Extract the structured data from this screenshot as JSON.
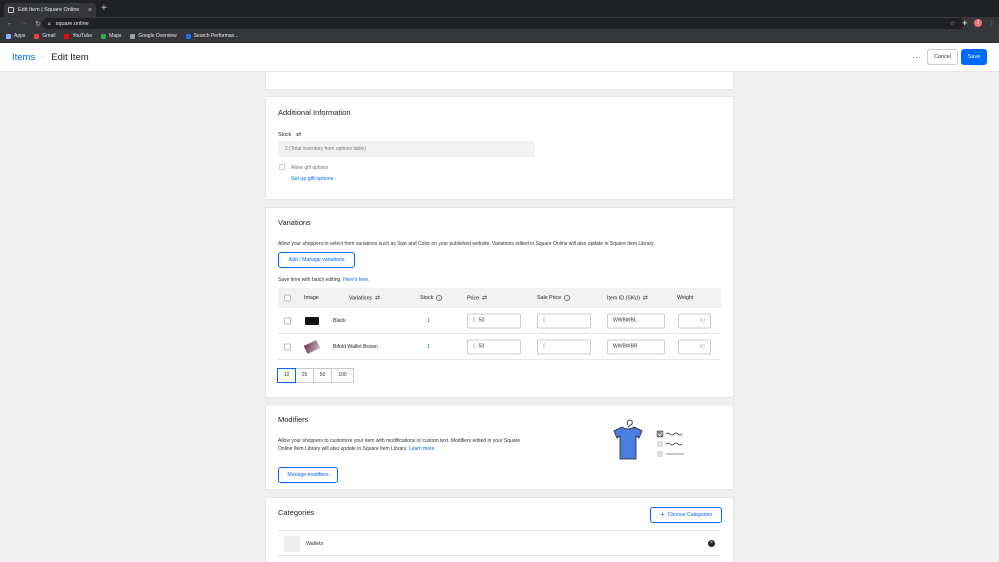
{
  "browser": {
    "tab_title": "Edit Item | Square Online",
    "url": "square.online",
    "profile_initial": "J",
    "bookmarks": [
      {
        "label": "Apps",
        "color": "#8ab4f8"
      },
      {
        "label": "Gmail",
        "color": "#ea4335"
      },
      {
        "label": "YouTube",
        "color": "#ff0000"
      },
      {
        "label": "Maps",
        "color": "#34a853"
      },
      {
        "label": "Google Overview",
        "color": "#9aa0a6"
      },
      {
        "label": "Search Performan...",
        "color": "#1a73e8"
      }
    ]
  },
  "header": {
    "breadcrumb_parent": "Items",
    "breadcrumb_separator": "›",
    "title": "Edit Item",
    "more": "···",
    "cancel_label": "Cancel",
    "save_label": "Save"
  },
  "additional": {
    "heading": "Additional Information",
    "stock_label": "Stock",
    "stock_value": "2 (Total inventory from options table)",
    "gift_label": "Allow gift options",
    "gift_link": "Set up gift options"
  },
  "variations": {
    "heading": "Variations",
    "description": "Allow your shoppers to select from variations such as Size and Color on your published website. Variations edited in Square Online will also update in Square Item Library.",
    "manage_button": "Add / Manage variations",
    "batch_text": "Save time with batch editing.",
    "batch_link": "Here's how.",
    "columns": {
      "image": "Image",
      "variations": "Variations",
      "stock": "Stock",
      "price": "Price",
      "sale_price": "Sale Price",
      "sku": "Item ID (SKU)",
      "weight": "Weight"
    },
    "rows": [
      {
        "name": "Black",
        "stock": "1",
        "currency": "£",
        "price": "50",
        "sale_price": "-",
        "sku": "WWBWBL",
        "weight_unit": "kg"
      },
      {
        "name": "Bifold Wallet Brown",
        "stock": "1",
        "currency": "£",
        "price": "50",
        "sale_price": "-",
        "sku": "WWBWBR",
        "weight_unit": "kg"
      }
    ],
    "page_sizes": [
      "10",
      "25",
      "50",
      "100"
    ]
  },
  "modifiers": {
    "heading": "Modifiers",
    "description_1": "Allow your shoppers to customize your item with modifications or custom text. Modifiers edited in your Square",
    "description_2": "Online Item Library will also update in Square Item Library.",
    "learn_more": "Learn more",
    "manage_button": "Manage modifiers"
  },
  "categories": {
    "heading": "Categories",
    "choose_button": "Choose Categories",
    "items": [
      {
        "name": "Wallets"
      }
    ]
  },
  "colors": {
    "accent": "#006aff",
    "illustration_blue": "#4a7fe0"
  }
}
